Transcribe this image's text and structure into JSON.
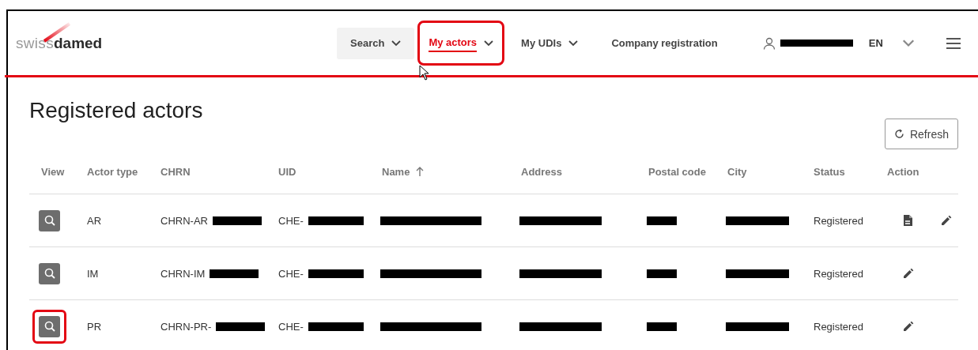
{
  "header": {
    "logo": {
      "light": "swiss",
      "dark": "damed"
    },
    "nav": [
      {
        "label": "Search",
        "dropdown": true,
        "selected": false,
        "shaded": true,
        "highlighted": false
      },
      {
        "label": "My actors",
        "dropdown": true,
        "selected": true,
        "shaded": false,
        "highlighted": true
      },
      {
        "label": "My UDIs",
        "dropdown": true,
        "selected": false,
        "shaded": false,
        "highlighted": false
      },
      {
        "label": "Company registration",
        "dropdown": false,
        "selected": false,
        "shaded": false,
        "highlighted": false
      }
    ],
    "user": {
      "redacted": true
    },
    "language": "EN"
  },
  "page": {
    "title": "Registered actors",
    "refresh_button": "Refresh"
  },
  "table": {
    "columns": [
      {
        "label": "View"
      },
      {
        "label": "Actor type"
      },
      {
        "label": "CHRN"
      },
      {
        "label": "UID"
      },
      {
        "label": "Name",
        "sorted": true
      },
      {
        "label": "Address"
      },
      {
        "label": "Postal code"
      },
      {
        "label": "City"
      },
      {
        "label": "Status"
      },
      {
        "label": "Action"
      }
    ],
    "rows": [
      {
        "cells": [
          {
            "kind": "view",
            "highlighted": false
          },
          {
            "text": "AR"
          },
          {
            "text": "CHRN-AR",
            "redacted": true
          },
          {
            "text": "CHE-",
            "redacted": true
          },
          {
            "redacted": true
          },
          {
            "redacted": true
          },
          {
            "redacted": true
          },
          {
            "redacted": true
          },
          {
            "text": "Registered"
          },
          {
            "kind": "actions",
            "actions": [
              {
                "kind": "document"
              },
              {
                "kind": "edit"
              }
            ]
          }
        ]
      },
      {
        "cells": [
          {
            "kind": "view",
            "highlighted": false
          },
          {
            "text": "IM"
          },
          {
            "text": "CHRN-IM",
            "redacted": true
          },
          {
            "text": "CHE-",
            "redacted": true
          },
          {
            "redacted": true
          },
          {
            "redacted": true
          },
          {
            "redacted": true
          },
          {
            "redacted": true
          },
          {
            "text": "Registered"
          },
          {
            "kind": "actions",
            "actions": [
              {
                "kind": "edit"
              }
            ]
          }
        ]
      },
      {
        "cells": [
          {
            "kind": "view",
            "highlighted": true
          },
          {
            "text": "PR"
          },
          {
            "text": "CHRN-PR-",
            "redacted": true
          },
          {
            "text": "CHE-",
            "redacted": true
          },
          {
            "redacted": true
          },
          {
            "redacted": true
          },
          {
            "redacted": true
          },
          {
            "redacted": true
          },
          {
            "text": "Registered"
          },
          {
            "kind": "actions",
            "actions": [
              {
                "kind": "edit"
              }
            ]
          }
        ]
      }
    ]
  }
}
